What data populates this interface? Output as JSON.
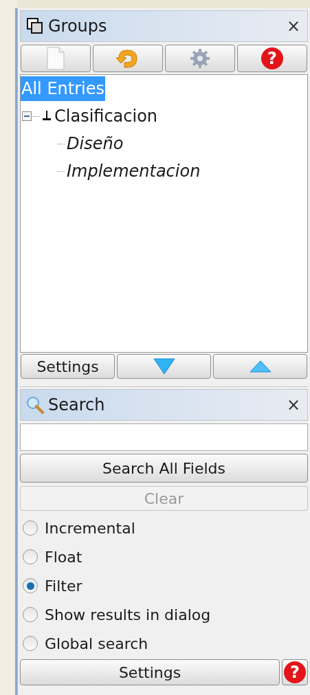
{
  "groups_panel": {
    "title": "Groups",
    "close": "×",
    "toolbar": [
      {
        "kind": "new"
      },
      {
        "kind": "refresh"
      },
      {
        "kind": "settings"
      },
      {
        "kind": "help",
        "glyph": "?"
      }
    ],
    "tree": [
      {
        "label": "All Entries",
        "selected": true,
        "italic": false,
        "children": [
          {
            "label": "Clasificacion",
            "selected": false,
            "italic": false,
            "expanded": true,
            "children": [
              {
                "label": "Diseño",
                "selected": false,
                "italic": true
              },
              {
                "label": "Implementacion",
                "selected": false,
                "italic": true
              }
            ]
          }
        ]
      }
    ],
    "bottom_buttons": [
      {
        "kind": "text",
        "label": "Settings"
      },
      {
        "kind": "down"
      },
      {
        "kind": "up"
      }
    ]
  },
  "search_panel": {
    "title": "Search",
    "close": "×",
    "search_button": "Search All Fields",
    "clear_button": {
      "label": "Clear",
      "disabled": true
    },
    "options": [
      {
        "label": "Incremental",
        "selected": false
      },
      {
        "label": "Float",
        "selected": false
      },
      {
        "label": "Filter",
        "selected": true
      },
      {
        "label": "Show results in dialog",
        "selected": false
      },
      {
        "label": "Global search",
        "selected": false
      }
    ],
    "settings_button": "Settings",
    "help_glyph": "?"
  }
}
